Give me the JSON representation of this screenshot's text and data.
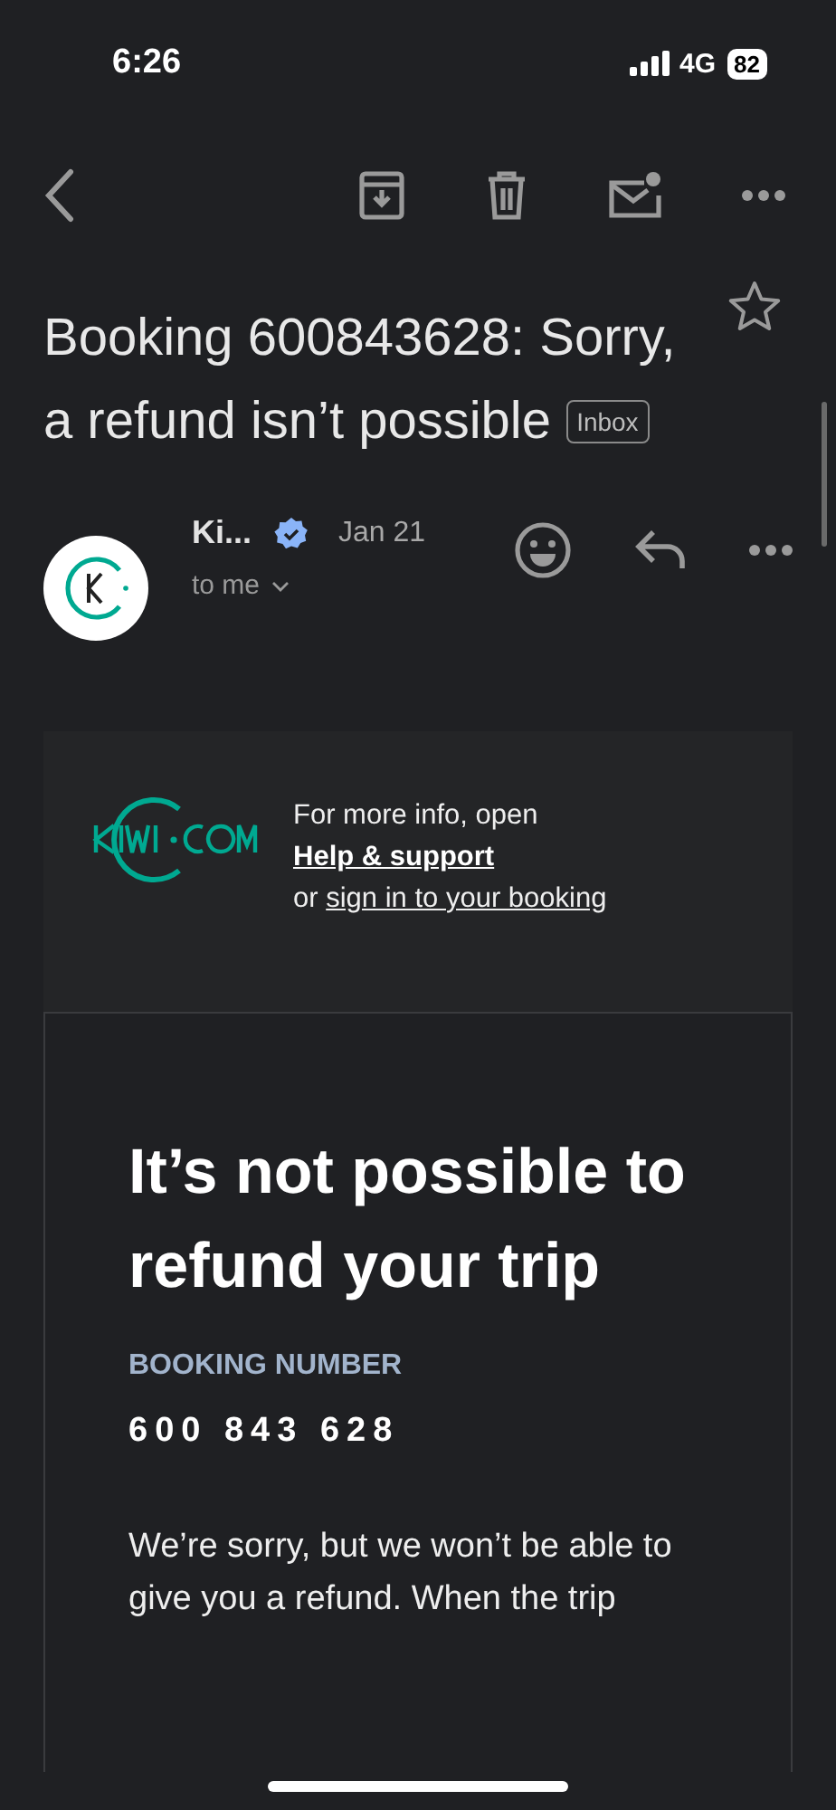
{
  "status_bar": {
    "time": "6:26",
    "network": "4G",
    "battery": "82"
  },
  "subject": {
    "text": "Booking 600843628: Sorry, a refund isn’t possible",
    "label": "Inbox",
    "starred": false
  },
  "sender": {
    "name": "Ki...",
    "verified": true,
    "date": "Jan 21",
    "recipient": "to me"
  },
  "email": {
    "header": {
      "intro": "For more info, open",
      "help_link": "Help & support",
      "or": "or",
      "sign_in_link": "sign in to your booking"
    },
    "heading": "It’s not possible to refund your trip",
    "booking_label": "BOOKING NUMBER",
    "booking_number": "600 843 628",
    "paragraph": "We’re sorry, but we won’t be able to give you a refund. When the trip"
  }
}
